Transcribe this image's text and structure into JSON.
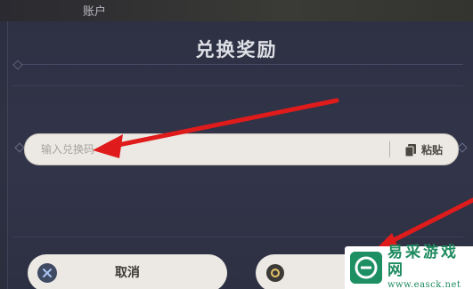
{
  "header": {
    "account_label": "账户"
  },
  "dialog": {
    "title": "兑换奖励",
    "input": {
      "placeholder": "输入兑换码",
      "value": ""
    },
    "paste_label": "粘贴",
    "cancel_label": "取消",
    "confirm_label": ""
  },
  "watermark": {
    "title": "易采游戏网",
    "url": "www.easck.net"
  },
  "colors": {
    "dialog_bg": "#30334a",
    "button_bg": "#ece9e4",
    "annotation_arrow": "#e01b1b",
    "watermark_green": "#1d8a5f"
  },
  "icons": {
    "cancel": "close-icon",
    "confirm": "circle-icon",
    "paste": "clipboard-icon"
  }
}
